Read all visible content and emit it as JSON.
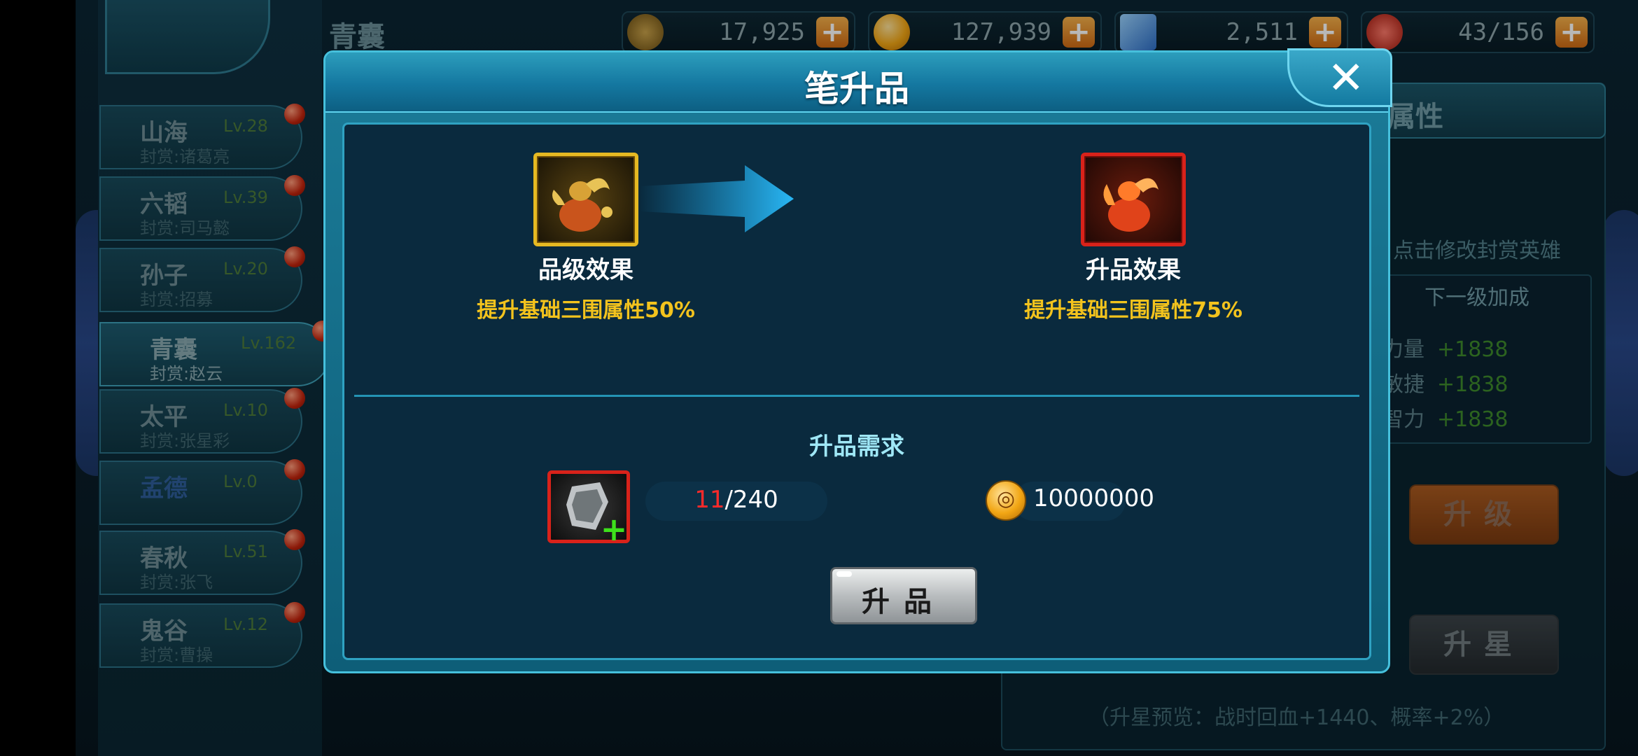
{
  "top_bar": {
    "title": "青囊",
    "resources": [
      {
        "icon": "medal-icon",
        "value": "17,925"
      },
      {
        "icon": "gold-coin-icon",
        "value": "127,939"
      },
      {
        "icon": "blue-crystal-icon",
        "value": "2,511"
      },
      {
        "icon": "meat-stamina-icon",
        "value": "43/156"
      }
    ],
    "add_label": "+"
  },
  "sidebar": {
    "items": [
      {
        "name": "山海",
        "level": "Lv.28",
        "sub": "封赏:诸葛亮"
      },
      {
        "name": "六韬",
        "level": "Lv.39",
        "sub": "封赏:司马懿"
      },
      {
        "name": "孙子",
        "level": "Lv.20",
        "sub": "封赏:招募"
      },
      {
        "name": "青囊",
        "level": "Lv.162",
        "sub": "封赏:赵云"
      },
      {
        "name": "太平",
        "level": "Lv.10",
        "sub": "封赏:张星彩"
      },
      {
        "name": "孟德",
        "level": "Lv.0",
        "sub": ""
      },
      {
        "name": "春秋",
        "level": "Lv.51",
        "sub": "封赏:张飞"
      },
      {
        "name": "鬼谷",
        "level": "Lv.12",
        "sub": "封赏:曹操"
      }
    ]
  },
  "right_panel": {
    "tab_label": "属性",
    "hint": "点击修改封赏英雄",
    "next_level_header": "下一级加成",
    "rows": [
      {
        "label": "力量",
        "value": "+1838"
      },
      {
        "label": "敏捷",
        "value": "+1838"
      },
      {
        "label": "智力",
        "value": "+1838"
      }
    ],
    "level_up_label": "升级",
    "star_up_label": "升星",
    "preview": "（升星预览：战时回血+1440、概率+2%）"
  },
  "dialog": {
    "title": "笔升品",
    "close_label": "✕",
    "current": {
      "label": "品级效果",
      "effect": "提升基础三围属性50%"
    },
    "next": {
      "label": "升品效果",
      "effect": "提升基础三围属性75%"
    },
    "requirements_title": "升品需求",
    "material_current": "11",
    "material_total": "/240",
    "cost": "10000000",
    "upgrade_button": "升品",
    "colors": {
      "gold_text": "#f3c31d",
      "insufficient": "#ff2a2a",
      "frame_gold": "#e6b922",
      "frame_red": "#d9221a"
    }
  }
}
